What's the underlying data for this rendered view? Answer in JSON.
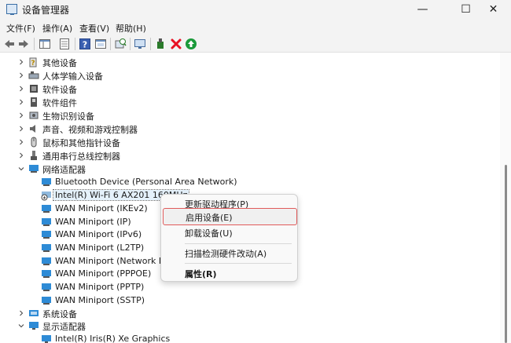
{
  "window": {
    "title": "设备管理器",
    "minimize": "—",
    "maximize": "☐",
    "close": "✕"
  },
  "menu": [
    "文件(F)",
    "操作(A)",
    "查看(V)",
    "帮助(H)"
  ],
  "colors": {
    "chrome_bg": "#f3f3f3",
    "highlight_border": "#e05a5a",
    "delete_red": "#e81123",
    "update_green": "#1a9a3a"
  },
  "tree": {
    "categories": [
      {
        "label": "其他设备",
        "icon": "unknown-device-icon"
      },
      {
        "label": "人体学输入设备",
        "icon": "hid-icon"
      },
      {
        "label": "软件设备",
        "icon": "software-device-icon"
      },
      {
        "label": "软件组件",
        "icon": "software-component-icon"
      },
      {
        "label": "生物识别设备",
        "icon": "biometric-icon"
      },
      {
        "label": "声音、视频和游戏控制器",
        "icon": "speaker-icon"
      },
      {
        "label": "鼠标和其他指针设备",
        "icon": "mouse-icon"
      },
      {
        "label": "通用串行总线控制器",
        "icon": "usb-icon"
      },
      {
        "label": "网络适配器",
        "icon": "network-adapter-icon",
        "expanded": true
      }
    ],
    "network_children": [
      "Bluetooth Device (Personal Area Network)",
      "Intel(R) Wi-Fi 6 AX201 160MHz",
      "WAN Miniport (IKEv2)",
      "WAN Miniport (IP)",
      "WAN Miniport (IPv6)",
      "WAN Miniport (L2TP)",
      "WAN Miniport (Network Monitor)",
      "WAN Miniport (PPPOE)",
      "WAN Miniport (PPTP)",
      "WAN Miniport (SSTP)"
    ],
    "system_devices": "系统设备",
    "display_adapters": "显示适配器",
    "display_children": [
      "Intel(R) Iris(R) Xe Graphics"
    ]
  },
  "context_menu": {
    "update_driver": "更新驱动程序(P)",
    "enable_device": "启用设备(E)",
    "uninstall_device": "卸载设备(U)",
    "scan_hardware": "扫描检测硬件改动(A)",
    "properties": "属性(R)"
  }
}
